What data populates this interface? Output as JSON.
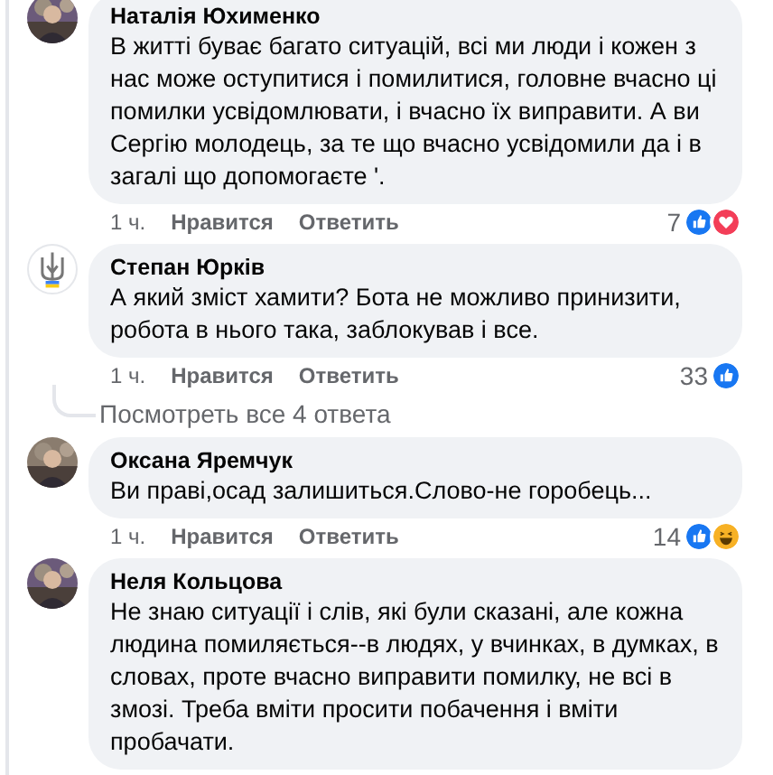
{
  "comments": [
    {
      "author": "Наталія Юхименко",
      "text": "В житті буває багато ситуацій, всі ми люди і кожен з нас може оступитися і помилитися, головне вчасно ці помилки усвідомлювати, і вчасно їх виправити. А ви Сергію молодець, за те що вчасно усвідомили да і в загалі що допомогаєте '.",
      "time": "1 ч.",
      "like": "Нравится",
      "reply": "Ответить",
      "count": "7",
      "reactions": [
        {
          "kind": "like"
        },
        {
          "kind": "love"
        }
      ]
    },
    {
      "avatar": {
        "kind": "emblem"
      },
      "author": "Степан Юрків",
      "text": "А який зміст хамити? Бота не можливо принизити, робота в нього така, заблокував і все.",
      "time": "1 ч.",
      "like": "Нравится",
      "reply": "Ответить",
      "count": "33",
      "reactions": [
        {
          "kind": "like"
        }
      ],
      "more_replies": "Посмотреть все 4 ответа"
    },
    {
      "author": "Оксана Яремчук",
      "text": "Ви праві,осад залишиться.Слово-не горобець...",
      "time": "1 ч.",
      "like": "Нравится",
      "reply": "Ответить",
      "count": "14",
      "reactions": [
        {
          "kind": "like"
        },
        {
          "kind": "haha"
        }
      ]
    },
    {
      "author": "Неля Кольцова",
      "text": "Не знаю ситуації і слів, які були сказані, але кожна людина помиляється--в людях, у вчинках, в думках, в словах, проте вчасно виправити помилку, не всі в змозі. Треба вміти просити побачення і вміти пробачати."
    }
  ]
}
